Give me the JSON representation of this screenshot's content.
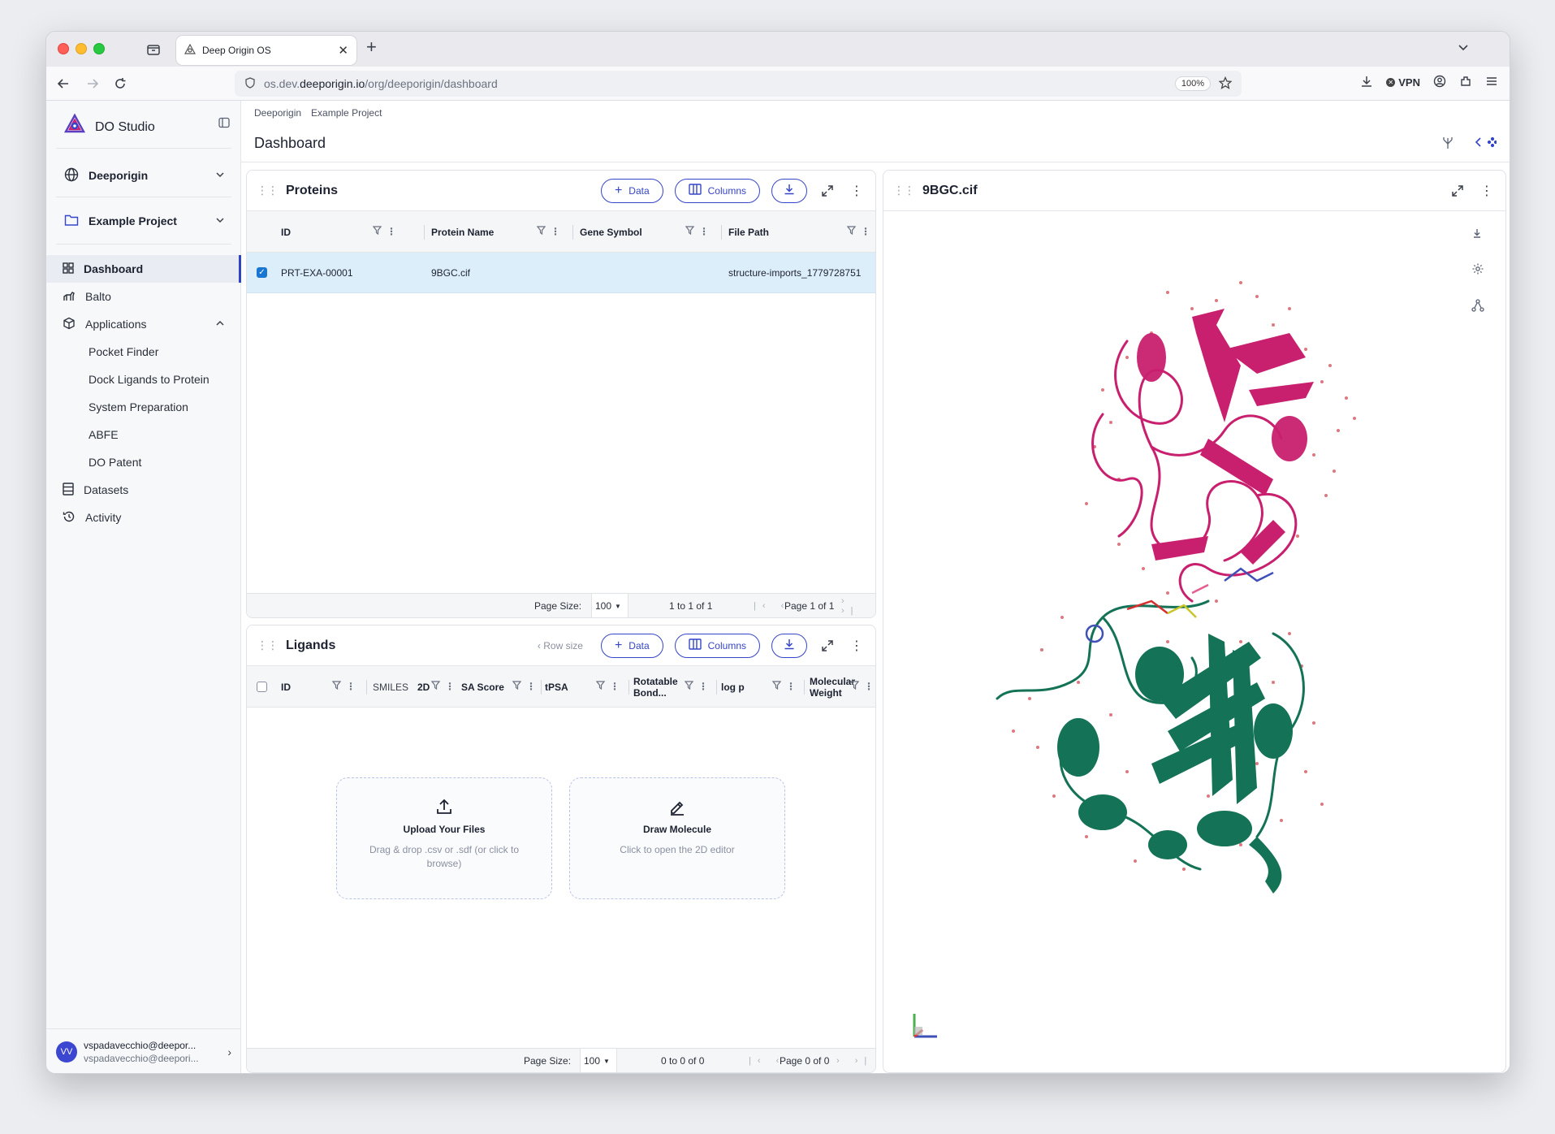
{
  "browser": {
    "tab_title": "Deep Origin OS",
    "url_prefix": "os.dev.",
    "url_domain": "deeporigin.io",
    "url_path": "/org/deeporigin/dashboard",
    "zoom": "100%",
    "vpn_label": "VPN"
  },
  "sidebar": {
    "brand": "DO Studio",
    "org": "Deeporigin",
    "project": "Example Project",
    "nav": {
      "dashboard": "Dashboard",
      "balto": "Balto",
      "applications": "Applications",
      "datasets": "Datasets",
      "activity": "Activity"
    },
    "apps": [
      "Pocket Finder",
      "Dock Ligands to Protein",
      "System Preparation",
      "ABFE",
      "DO Patent"
    ],
    "user": {
      "initials": "VV",
      "name": "vspadavecchio@deepor...",
      "email": "vspadavecchio@deepori..."
    }
  },
  "main": {
    "breadcrumb": [
      "Deeporigin",
      "Example Project"
    ],
    "title": "Dashboard"
  },
  "proteins": {
    "title": "Proteins",
    "data_label": "Data",
    "columns_label": "Columns",
    "headers": [
      "ID",
      "Protein Name",
      "Gene Symbol",
      "File Path"
    ],
    "row": {
      "id": "PRT-EXA-00001",
      "name": "9BGC.cif",
      "gene": "",
      "path": "structure-imports_1779728751"
    },
    "footer": {
      "page_size_label": "Page Size:",
      "page_size": "100",
      "range": "1 to 1 of 1",
      "page": "Page 1 of 1"
    }
  },
  "ligands": {
    "title": "Ligands",
    "row_size": "Row size",
    "data_label": "Data",
    "columns_label": "Columns",
    "headers": {
      "id": "ID",
      "smiles": "SMILES",
      "twod": "2D",
      "sa": "SA Score",
      "tpsa": "tPSA",
      "rot1": "Rotatable",
      "rot2": "Bond...",
      "logp": "log p",
      "mw1": "Molecular",
      "mw2": "Weight"
    },
    "upload": {
      "title": "Upload Your Files",
      "subtitle": "Drag & drop .csv or .sdf (or click to browse)"
    },
    "draw": {
      "title": "Draw Molecule",
      "subtitle": "Click to open the 2D editor"
    },
    "footer": {
      "page_size_label": "Page Size:",
      "page_size": "100",
      "range": "0 to 0 of 0",
      "page": "Page 0 of 0"
    }
  },
  "viewer": {
    "title": "9BGC.cif"
  },
  "colors": {
    "accent": "#3545c9",
    "chain_a": "#c8206e",
    "chain_b": "#147256",
    "selected_row": "#ddeefb"
  }
}
